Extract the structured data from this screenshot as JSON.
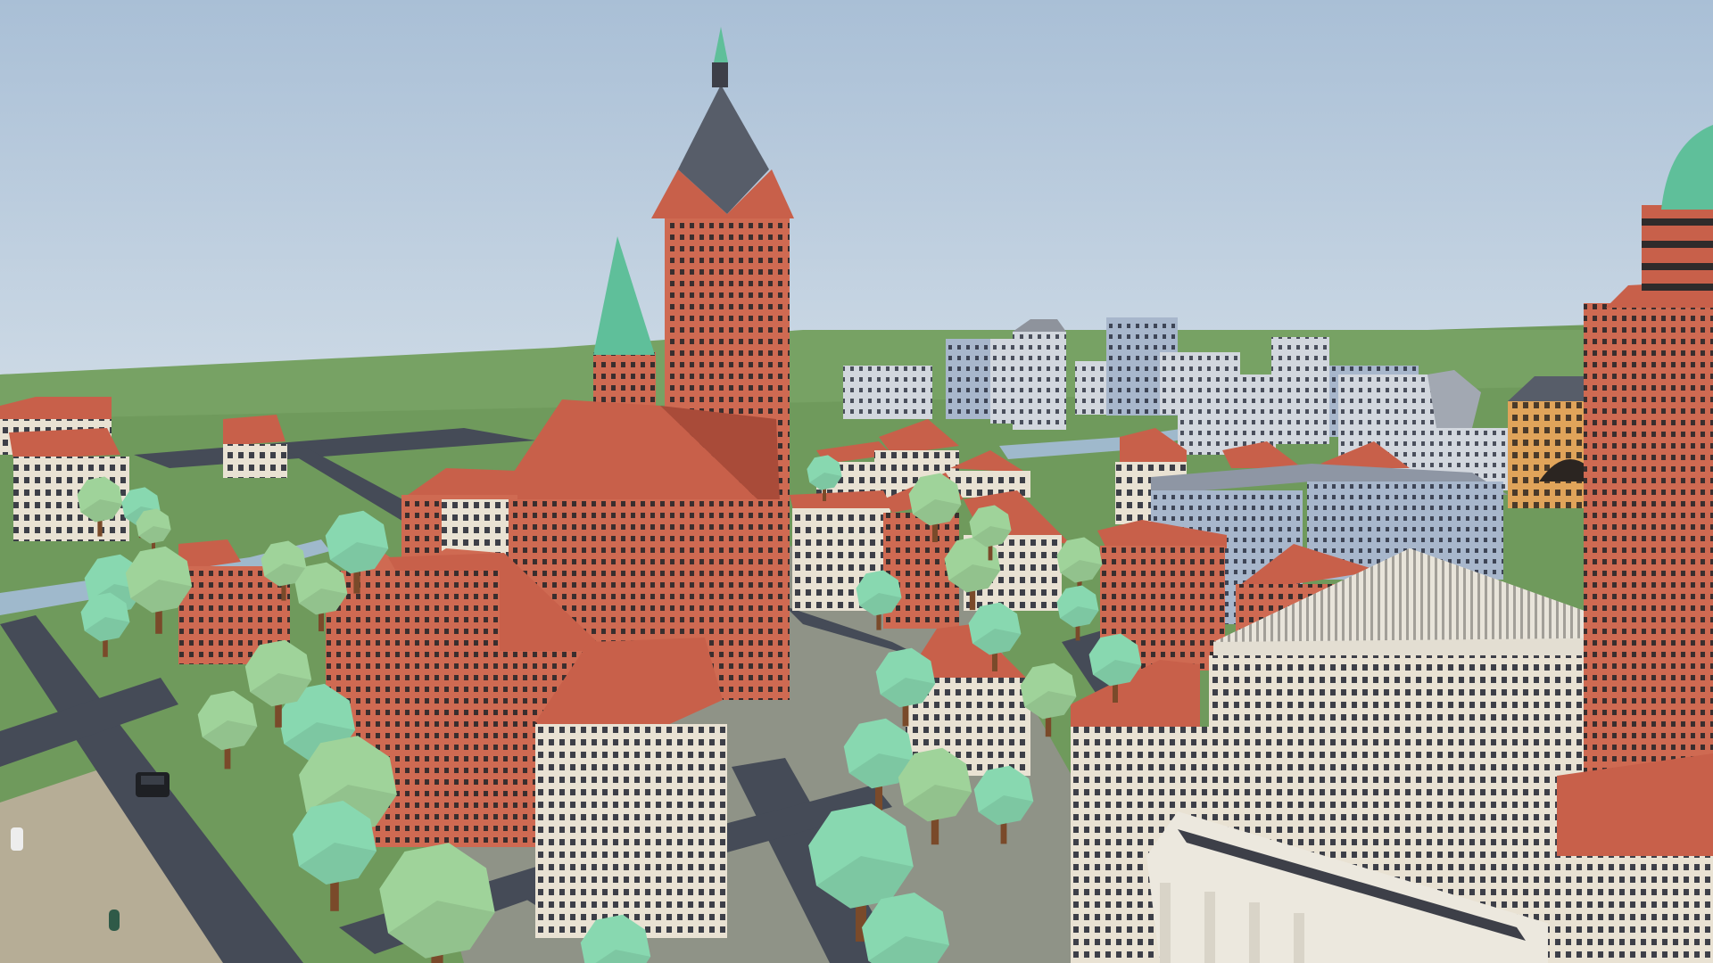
{
  "scene": {
    "kind": "low-poly 3D city viewport",
    "colors": {
      "sky_top": "#a9bfd6",
      "sky_horizon": "#ccd9e5",
      "grass": "#6f9a5c",
      "grass_light": "#7fa86a",
      "road": "#454b57",
      "plaza": "#8f9387",
      "sand": "#b6ad96",
      "water": "#9fb9cc",
      "roof_red": "#c8604a",
      "roof_red_dark": "#a94b39",
      "brick_red": "#cf6a52",
      "cream_wall": "#e9e2d3",
      "grey_wall": "#c9cfd8",
      "blue_wall": "#9fb0c8",
      "slate_roof": "#575d69",
      "copper_green": "#5fbf9a",
      "tree_light": "#9fd39a",
      "tree_mint": "#88d8b0",
      "trunk": "#7a4a2a",
      "window_dark": "#3d3f48",
      "orange_wall": "#e0a45a"
    },
    "landmarks": [
      "church-tower-icon",
      "copper-spire-icon",
      "dome-tower-icon",
      "classical-hall-icon"
    ]
  }
}
